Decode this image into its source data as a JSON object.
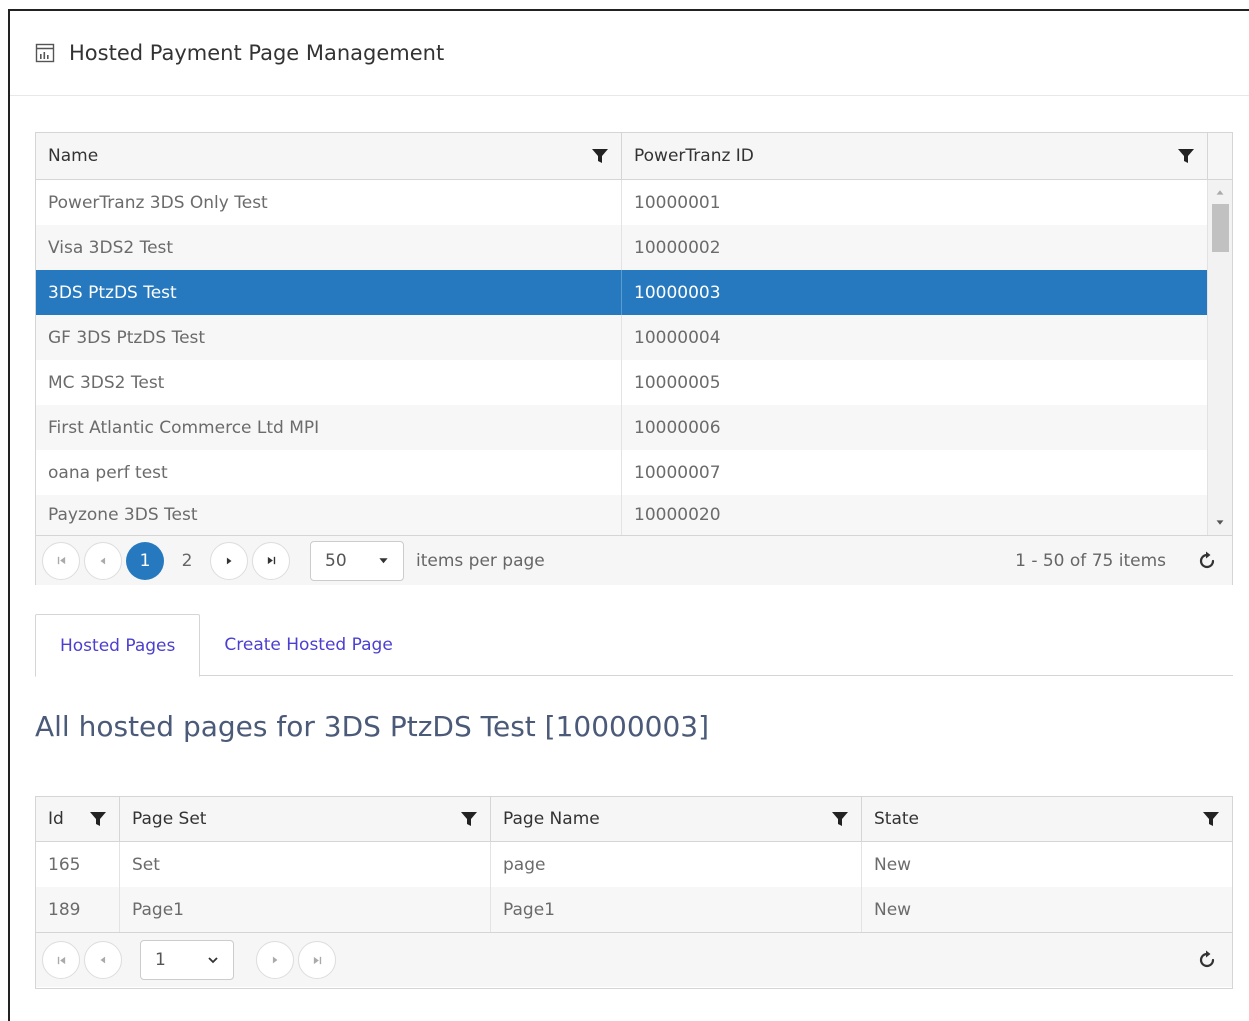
{
  "header": {
    "title": "Hosted Payment Page Management",
    "icon": "report-window-icon"
  },
  "merchants_grid": {
    "columns": [
      "Name",
      "PowerTranz ID"
    ],
    "rows": [
      {
        "name": "PowerTranz 3DS Only Test",
        "id": "10000001"
      },
      {
        "name": "Visa 3DS2 Test",
        "id": "10000002"
      },
      {
        "name": "3DS PtzDS Test",
        "id": "10000003",
        "selected": true
      },
      {
        "name": "GF 3DS PtzDS Test",
        "id": "10000004"
      },
      {
        "name": "MC 3DS2 Test",
        "id": "10000005"
      },
      {
        "name": "First Atlantic Commerce Ltd MPI",
        "id": "10000006"
      },
      {
        "name": "oana perf test",
        "id": "10000007"
      },
      {
        "name": "Payzone 3DS Test",
        "id": "10000020"
      }
    ],
    "pager": {
      "pages": [
        "1",
        "2"
      ],
      "current_page": "1",
      "page_size": "50",
      "items_per_page_label": "items per page",
      "info": "1 - 50 of 75 items"
    }
  },
  "tabs": [
    {
      "label": "Hosted Pages",
      "active": true
    },
    {
      "label": "Create Hosted Page",
      "active": false
    }
  ],
  "section_title": "All hosted pages for 3DS PtzDS Test [10000003]",
  "pages_grid": {
    "columns": [
      "Id",
      "Page Set",
      "Page Name",
      "State"
    ],
    "rows": [
      {
        "id": "165",
        "page_set": "Set",
        "page_name": "page",
        "state": "New"
      },
      {
        "id": "189",
        "page_set": "Page1",
        "page_name": "Page1",
        "state": "New"
      }
    ],
    "pager": {
      "page_select_value": "1"
    }
  },
  "colors": {
    "accent": "#2679be",
    "tab_text": "#4b3fd0",
    "title_text": "#4b5a78"
  }
}
